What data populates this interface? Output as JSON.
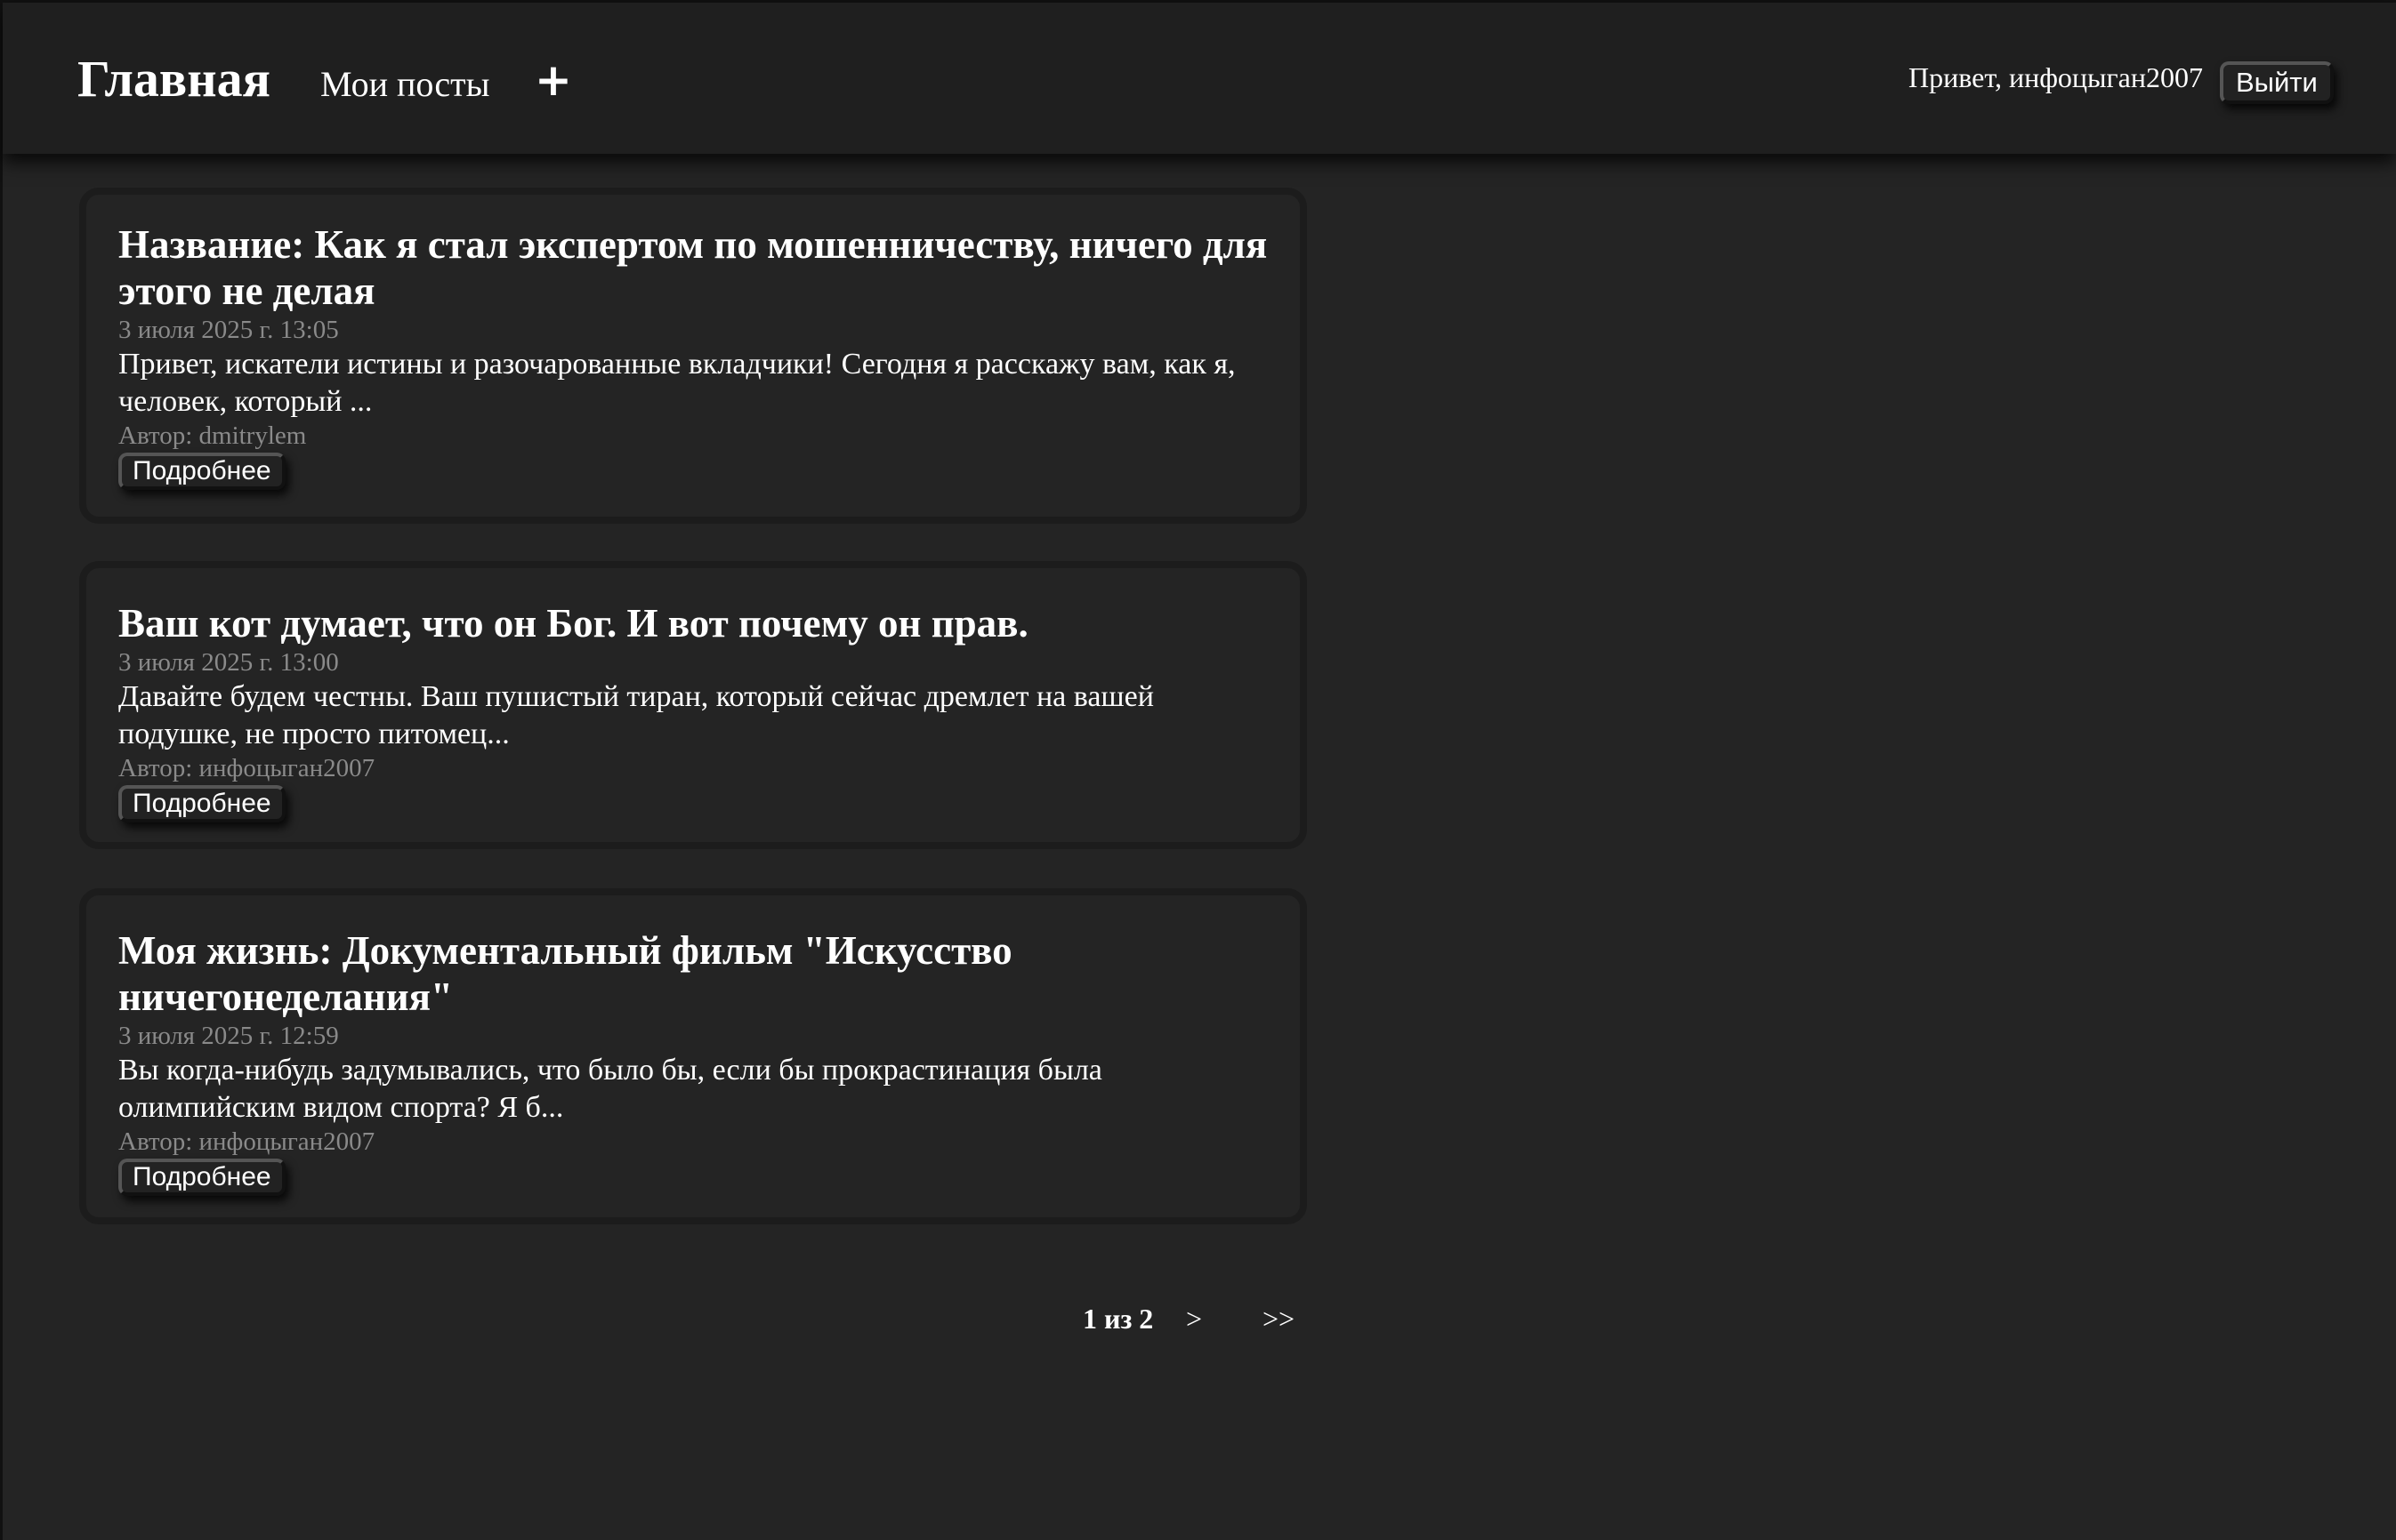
{
  "header": {
    "home": "Главная",
    "my_posts": "Мои посты",
    "add_icon": "+",
    "greeting": "Привет, инфоцыган2007",
    "logout": "Выйти"
  },
  "posts": [
    {
      "title": "Название: Как я стал экспертом по мошенничеству, ничего для этого не делая",
      "date": "3 июля 2025 г. 13:05",
      "excerpt": "Привет, искатели истины и разочарованные вкладчики! Сегодня я расскажу вам, как я, человек, который ...",
      "author": "Автор: dmitrylem",
      "more": "Подробнее"
    },
    {
      "title": "Ваш кот думает, что он Бог. И вот почему он прав.",
      "date": "3 июля 2025 г. 13:00",
      "excerpt": "Давайте будем честны. Ваш пушистый тиран, который сейчас дремлет на вашей подушке, не просто питомец...",
      "author": "Автор: инфоцыган2007",
      "more": "Подробнее"
    },
    {
      "title": "Моя жизнь: Документальный фильм \"Искусство ничегонеделания\"",
      "date": "3 июля 2025 г. 12:59",
      "excerpt": "Вы когда-нибудь задумывались, что было бы, если бы прокрастинация была олимпийским видом спорта? Я б...",
      "author": "Автор: инфоцыган2007",
      "more": "Подробнее"
    }
  ],
  "pagination": {
    "current": "1 из 2",
    "next": ">",
    "last": ">>"
  }
}
